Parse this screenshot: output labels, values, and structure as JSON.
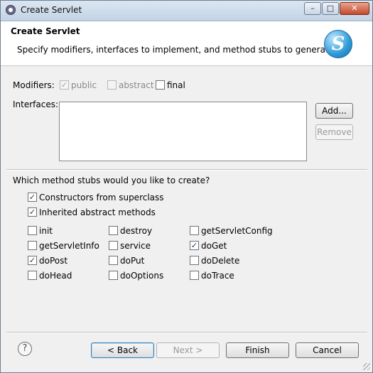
{
  "window": {
    "title": "Create Servlet",
    "controls": [
      "–",
      "□",
      "✕"
    ]
  },
  "header": {
    "title": "Create Servlet",
    "description": "Specify modifiers, interfaces to implement, and method stubs to generate.",
    "logo_icon": "servlet-s-icon"
  },
  "modifiers": {
    "label": "Modifiers:",
    "options": [
      {
        "label": "public",
        "checked": true,
        "enabled": false
      },
      {
        "label": "abstract",
        "checked": false,
        "enabled": false
      },
      {
        "label": "final",
        "checked": false,
        "enabled": true
      }
    ]
  },
  "interfaces": {
    "label": "Interfaces:",
    "add_label": "Add...",
    "remove_label": "Remove"
  },
  "stubs": {
    "question": "Which method stubs would you like to create?",
    "constructors": "Constructors from superclass",
    "inherited": "Inherited abstract methods",
    "methods": [
      [
        "init",
        "destroy",
        "getServletConfig"
      ],
      [
        "getServletInfo",
        "service",
        "doGet"
      ],
      [
        "doPost",
        "doPut",
        "doDelete"
      ],
      [
        "doHead",
        "doOptions",
        "doTrace"
      ]
    ],
    "checked": {
      "constructors": true,
      "inherited": true,
      "doGet": true,
      "doPost": true
    }
  },
  "footer": {
    "back_label": "< Back",
    "next_label": "Next >",
    "finish_label": "Finish",
    "cancel_label": "Cancel",
    "help_icon": "help-icon"
  }
}
